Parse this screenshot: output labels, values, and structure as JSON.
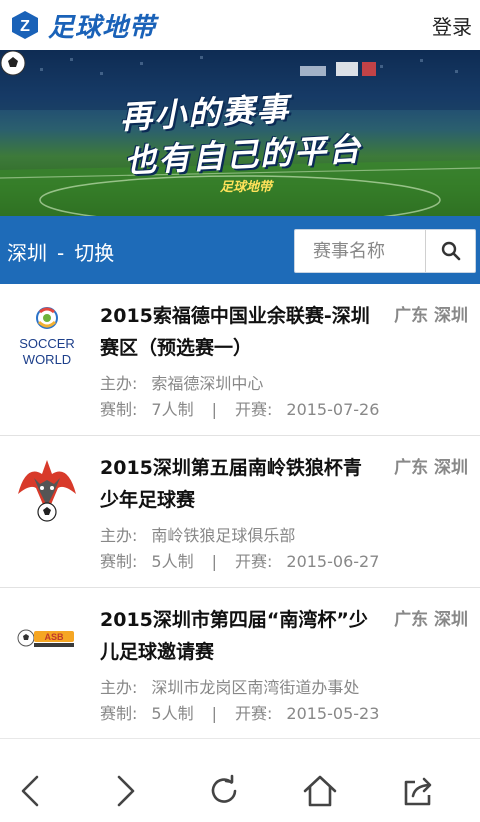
{
  "header": {
    "logo_text": "足球地带",
    "login_label": "登录",
    "brand_color": "#1a62b8"
  },
  "banner": {
    "line1": "再小的赛事",
    "line2": "也有自己的平台",
    "brand": "足球地带"
  },
  "citybar": {
    "city": "深圳",
    "separator": "-",
    "switch_label": "切换",
    "bar_color": "#1e6bb8"
  },
  "search": {
    "placeholder": "赛事名称",
    "icon": "search-icon"
  },
  "events": [
    {
      "title": "2015索福德中国业余联赛-深圳赛区（预选赛一）",
      "region": "广东 深圳",
      "host_label": "主办:",
      "host": "索福德深圳中心",
      "format_label": "赛制:",
      "format": "7人制",
      "divider": "|",
      "start_label": "开赛:",
      "start": "2015-07-26",
      "logo": "soccer-world-logo"
    },
    {
      "title": "2015深圳第五届南岭铁狼杯青少年足球赛",
      "region": "广东 深圳",
      "host_label": "主办:",
      "host": "南岭铁狼足球俱乐部",
      "format_label": "赛制:",
      "format": "5人制",
      "divider": "|",
      "start_label": "开赛:",
      "start": "2015-06-27",
      "logo": "wolf-logo"
    },
    {
      "title": "2015深圳市第四届“南湾杯”少儿足球邀请赛",
      "region": "广东 深圳",
      "host_label": "主办:",
      "host": "深圳市龙岗区南湾街道办事处",
      "format_label": "赛制:",
      "format": "5人制",
      "divider": "|",
      "start_label": "开赛:",
      "start": "2015-05-23",
      "logo": "asb-logo"
    }
  ],
  "bottom_nav": [
    {
      "icon": "back-arrow-icon"
    },
    {
      "icon": "forward-arrow-icon"
    },
    {
      "icon": "refresh-icon"
    },
    {
      "icon": "home-icon"
    },
    {
      "icon": "share-icon"
    }
  ]
}
